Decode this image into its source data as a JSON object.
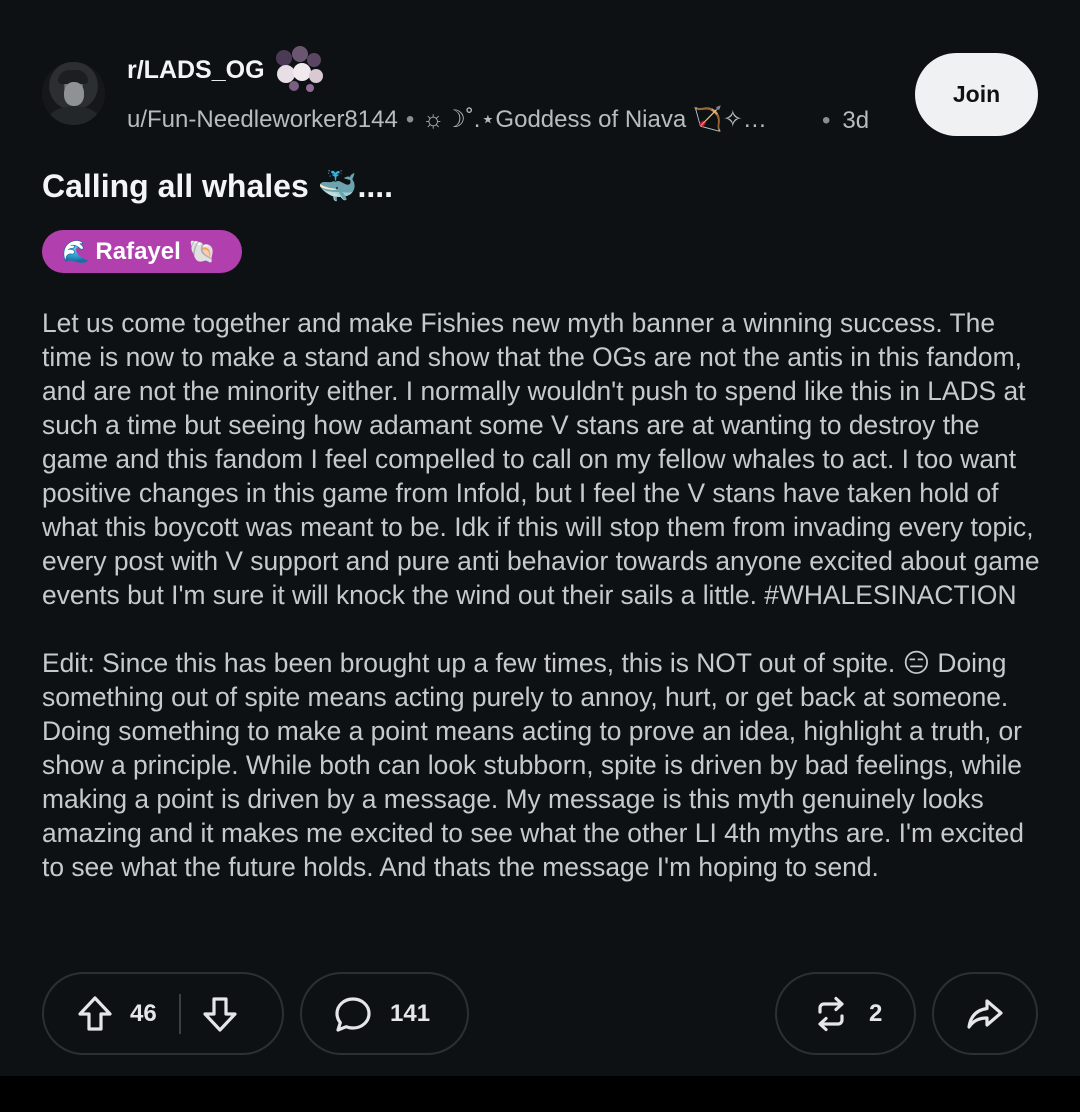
{
  "header": {
    "subreddit": "r/LADS_OG",
    "username": "u/Fun-Needleworker8144",
    "user_flair": "☼☽˚.⋆Goddess of Niava 🏹✧…",
    "time_ago": "3d",
    "join_label": "Join"
  },
  "post": {
    "title": "Calling all whales 🐳....",
    "flair": {
      "emoji_left": "🌊",
      "label": "Rafayel",
      "emoji_right": "🐚",
      "color": "#b13fad"
    },
    "paragraphs": [
      "Let us come together and make Fishies new myth banner a winning success. The time is now to make a stand and show that the OGs are not the antis in this fandom, and are not the minority either. I normally wouldn't push to spend like this in LADS at such a time but seeing how adamant some V stans are at wanting to destroy the game and this fandom I feel compelled to call on my fellow whales to act. I too want positive changes in this game from Infold, but I feel the V stans have taken hold of what this boycott was meant to be. Idk if this will stop them from invading every topic, every post with V support and pure anti behavior towards anyone excited about game events but I'm sure it will knock the wind out their sails a little. #WHALESINACTION",
      "Edit: Since this has been brought up a few times, this is NOT out of spite. 😑 Doing something out of spite means acting purely to annoy, hurt, or get back at someone. Doing something to make a point means acting to prove an idea, highlight a truth, or show a principle. While both can look stubborn, spite is driven by bad feelings, while making a point is driven by a message. My message is this myth genuinely looks amazing and it makes me excited to see what the other LI 4th myths are. I'm excited to see what the future holds. And thats the message I'm hoping to send."
    ]
  },
  "actions": {
    "upvote_count": "46",
    "comment_count": "141",
    "repost_count": "2"
  },
  "icons": {
    "upvote": "upvote-arrow-icon",
    "downvote": "downvote-arrow-icon",
    "comment": "comment-bubble-icon",
    "repost": "repost-icon",
    "share": "share-arrow-icon"
  },
  "colors": {
    "background": "#0e1113",
    "flair": "#b13fad",
    "join_button": "#f0f1f2"
  }
}
